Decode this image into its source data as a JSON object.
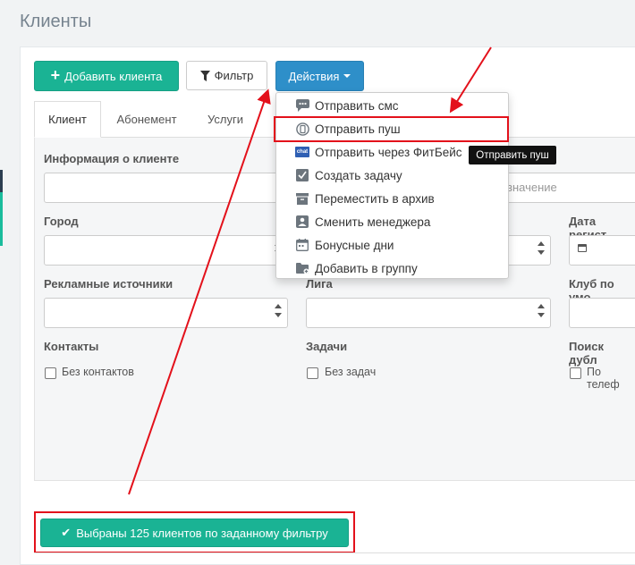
{
  "page": {
    "title": "Клиенты"
  },
  "toolbar": {
    "add_label": "Добавить клиента",
    "filter_label": "Фильтр",
    "actions_label": "Действия"
  },
  "tabs": [
    {
      "label": "Клиент",
      "active": true
    },
    {
      "label": "Абонемент"
    },
    {
      "label": "Услуги"
    }
  ],
  "form": {
    "client_info_label": "Информация о клиенте",
    "value_placeholder": "значение",
    "city_label": "Город",
    "reg_date_label": "Дата регист",
    "ad_sources_label": "Рекламные источники",
    "league_label": "Лига",
    "club_label": "Клуб по умо",
    "contacts_label": "Контакты",
    "no_contacts_label": "Без контактов",
    "tasks_label": "Задачи",
    "no_tasks_label": "Без задач",
    "dup_search_label": "Поиск дубл",
    "by_phone_label": "По телеф"
  },
  "actions_menu": [
    {
      "label": "Отправить смс",
      "icon": "sms-icon"
    },
    {
      "label": "Отправить пуш",
      "icon": "push-icon"
    },
    {
      "label": "Отправить через ФитБейс",
      "icon": "chat-icon"
    },
    {
      "label": "Создать задачу",
      "icon": "task-icon"
    },
    {
      "label": "Переместить в архив",
      "icon": "archive-icon"
    },
    {
      "label": "Сменить менеджера",
      "icon": "manager-icon"
    },
    {
      "label": "Бонусные дни",
      "icon": "calendar-icon"
    },
    {
      "label": "Добавить в группу",
      "icon": "folder-add-icon"
    }
  ],
  "chat_icon_text": "chat",
  "tooltip": "Отправить пуш",
  "selected_button_label": "Выбраны 125 клиентов по заданному фильтру",
  "colors": {
    "primary_green": "#1ab394",
    "actions_blue": "#2e8fc9",
    "annotation_red": "#e3111b",
    "icon_gray": "#6c757d"
  }
}
